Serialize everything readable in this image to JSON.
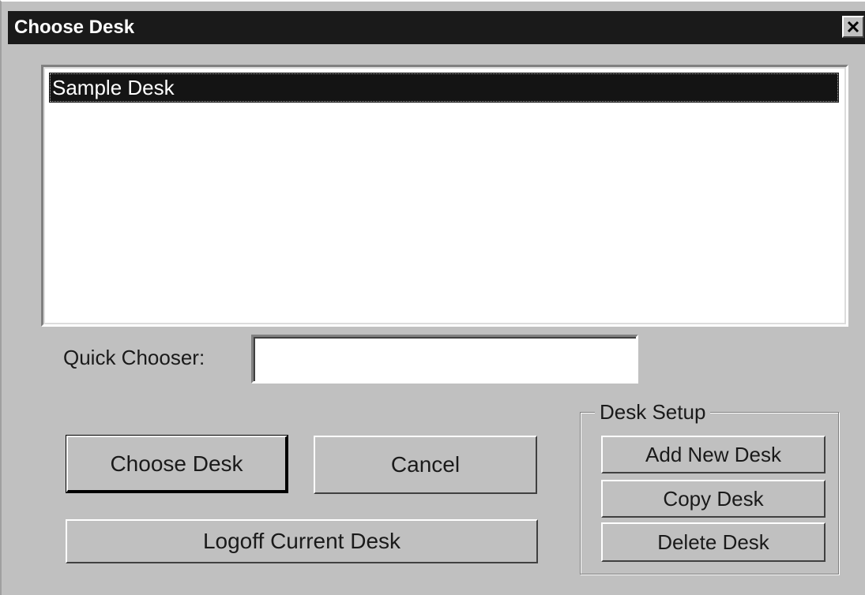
{
  "window": {
    "title": "Choose Desk",
    "close_glyph": "✕",
    "close_icon": "close-icon"
  },
  "list": {
    "items": [
      "Sample Desk"
    ],
    "selected_index": 0
  },
  "quick_chooser": {
    "label": "Quick Chooser:",
    "value": ""
  },
  "buttons": {
    "choose_desk": "Choose Desk",
    "cancel": "Cancel",
    "logoff": "Logoff Current Desk"
  },
  "desk_setup": {
    "title": "Desk Setup",
    "add": "Add New Desk",
    "copy": "Copy Desk",
    "delete": "Delete Desk"
  },
  "colors": {
    "face": "#c0c0c0",
    "titlebar": "#1a1a1a",
    "selection": "#141414"
  }
}
